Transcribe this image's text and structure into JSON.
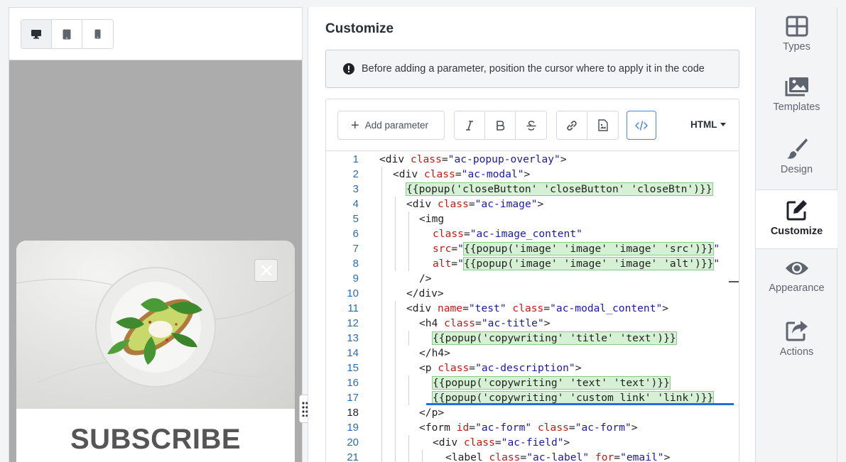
{
  "preview": {
    "devices": [
      {
        "name": "desktop",
        "active": true
      },
      {
        "name": "tablet",
        "active": false
      },
      {
        "name": "mobile",
        "active": false
      }
    ],
    "popup_title": "SUBSCRIBE"
  },
  "editor": {
    "title": "Customize",
    "notice": "Before adding a parameter, position the cursor where to apply it in the code",
    "add_parameter_label": "Add parameter",
    "language": "HTML",
    "current_line": "18"
  },
  "code_lines": [
    {
      "n": "1"
    },
    {
      "n": "2"
    },
    {
      "n": "3"
    },
    {
      "n": "4"
    },
    {
      "n": "5"
    },
    {
      "n": "6"
    },
    {
      "n": "7"
    },
    {
      "n": "8"
    },
    {
      "n": "9"
    },
    {
      "n": "10"
    },
    {
      "n": "11"
    },
    {
      "n": "12"
    },
    {
      "n": "13"
    },
    {
      "n": "14"
    },
    {
      "n": "15"
    },
    {
      "n": "16"
    },
    {
      "n": "17"
    },
    {
      "n": "18"
    },
    {
      "n": "19"
    },
    {
      "n": "20"
    },
    {
      "n": "21"
    }
  ],
  "code": {
    "l1": [
      "<div ",
      "class",
      "=",
      "\"ac-popup-overlay\"",
      ">"
    ],
    "l2": [
      "<div ",
      "class",
      "=",
      "\"ac-modal\"",
      ">"
    ],
    "l3": "{{popup('closeButton' 'closeButton' 'closeBtn')}}",
    "l4": [
      "<div ",
      "class",
      "=",
      "\"ac-image\"",
      ">"
    ],
    "l5": "<img",
    "l6": [
      "class",
      "=",
      "\"ac-image_content\""
    ],
    "l7": [
      "src",
      "=",
      "\"",
      "{{popup('image' 'image' 'image' 'src')}}",
      "\""
    ],
    "l8": [
      "alt",
      "=",
      "\"",
      "{{popup('image' 'image' 'image' 'alt')}}",
      "\""
    ],
    "l9": "/>",
    "l10": "</div>",
    "l11": [
      "<div ",
      "name",
      "=",
      "\"test\"",
      " ",
      "class",
      "=",
      "\"ac-modal_content\"",
      ">"
    ],
    "l12": [
      "<h4 ",
      "class",
      "=",
      "\"ac-title\"",
      ">"
    ],
    "l13": "{{popup('copywriting' 'title' 'text')}}",
    "l14": "</h4>",
    "l15": [
      "<p ",
      "class",
      "=",
      "\"ac-description\"",
      ">"
    ],
    "l16": "{{popup('copywriting' 'text' 'text')}}",
    "l17": "{{popup('copywriting' 'custom_link' 'link')}}",
    "l18": "</p>",
    "l19": [
      "<form ",
      "id",
      "=",
      "\"ac-form\"",
      " ",
      "class",
      "=",
      "\"ac-form\"",
      ">"
    ],
    "l20": [
      "<div ",
      "class",
      "=",
      "\"ac-field\"",
      ">"
    ],
    "l21": [
      "<label ",
      "class",
      "=",
      "\"ac-label\"",
      " ",
      "for",
      "=",
      "\"email\"",
      ">"
    ]
  },
  "sidebar": {
    "items": [
      {
        "label": "Types",
        "icon": "grid-icon",
        "active": false
      },
      {
        "label": "Templates",
        "icon": "images-icon",
        "active": false
      },
      {
        "label": "Design",
        "icon": "brush-icon",
        "active": false
      },
      {
        "label": "Customize",
        "icon": "edit-icon",
        "active": true
      },
      {
        "label": "Appearance",
        "icon": "eye-icon",
        "active": false
      },
      {
        "label": "Actions",
        "icon": "share-icon",
        "active": false
      }
    ]
  },
  "colors": {
    "accent": "#4a8ad8",
    "cursor_line": "#1f6fe0",
    "template_bg": "#d6f0d6",
    "attr": "#c41a16",
    "string": "#1a1aa6"
  }
}
